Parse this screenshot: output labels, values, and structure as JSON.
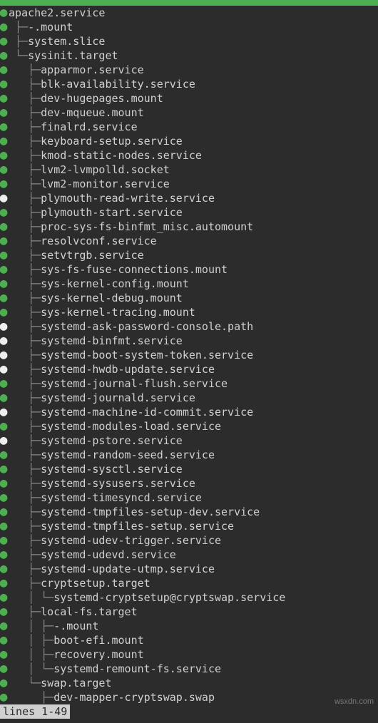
{
  "topbar_color": "#4caf50",
  "status_line": "lines 1-49",
  "watermark": "wsxdn.com",
  "root": {
    "name": "apache2.service",
    "bullet": "green"
  },
  "lines": [
    {
      "bullet": "green",
      "prefix": " ├─",
      "text": "-.mount"
    },
    {
      "bullet": "green",
      "prefix": " ├─",
      "text": "system.slice"
    },
    {
      "bullet": "green",
      "prefix": " └─",
      "text": "sysinit.target"
    },
    {
      "bullet": "green",
      "prefix": "   ├─",
      "text": "apparmor.service"
    },
    {
      "bullet": "green",
      "prefix": "   ├─",
      "text": "blk-availability.service"
    },
    {
      "bullet": "green",
      "prefix": "   ├─",
      "text": "dev-hugepages.mount"
    },
    {
      "bullet": "green",
      "prefix": "   ├─",
      "text": "dev-mqueue.mount"
    },
    {
      "bullet": "green",
      "prefix": "   ├─",
      "text": "finalrd.service"
    },
    {
      "bullet": "green",
      "prefix": "   ├─",
      "text": "keyboard-setup.service"
    },
    {
      "bullet": "green",
      "prefix": "   ├─",
      "text": "kmod-static-nodes.service"
    },
    {
      "bullet": "green",
      "prefix": "   ├─",
      "text": "lvm2-lvmpolld.socket"
    },
    {
      "bullet": "green",
      "prefix": "   ├─",
      "text": "lvm2-monitor.service"
    },
    {
      "bullet": "white",
      "prefix": "   ├─",
      "text": "plymouth-read-write.service"
    },
    {
      "bullet": "green",
      "prefix": "   ├─",
      "text": "plymouth-start.service"
    },
    {
      "bullet": "green",
      "prefix": "   ├─",
      "text": "proc-sys-fs-binfmt_misc.automount"
    },
    {
      "bullet": "green",
      "prefix": "   ├─",
      "text": "resolvconf.service"
    },
    {
      "bullet": "green",
      "prefix": "   ├─",
      "text": "setvtrgb.service"
    },
    {
      "bullet": "green",
      "prefix": "   ├─",
      "text": "sys-fs-fuse-connections.mount"
    },
    {
      "bullet": "green",
      "prefix": "   ├─",
      "text": "sys-kernel-config.mount"
    },
    {
      "bullet": "green",
      "prefix": "   ├─",
      "text": "sys-kernel-debug.mount"
    },
    {
      "bullet": "green",
      "prefix": "   ├─",
      "text": "sys-kernel-tracing.mount"
    },
    {
      "bullet": "white",
      "prefix": "   ├─",
      "text": "systemd-ask-password-console.path"
    },
    {
      "bullet": "white",
      "prefix": "   ├─",
      "text": "systemd-binfmt.service"
    },
    {
      "bullet": "white",
      "prefix": "   ├─",
      "text": "systemd-boot-system-token.service"
    },
    {
      "bullet": "white",
      "prefix": "   ├─",
      "text": "systemd-hwdb-update.service"
    },
    {
      "bullet": "green",
      "prefix": "   ├─",
      "text": "systemd-journal-flush.service"
    },
    {
      "bullet": "green",
      "prefix": "   ├─",
      "text": "systemd-journald.service"
    },
    {
      "bullet": "white",
      "prefix": "   ├─",
      "text": "systemd-machine-id-commit.service"
    },
    {
      "bullet": "green",
      "prefix": "   ├─",
      "text": "systemd-modules-load.service"
    },
    {
      "bullet": "white",
      "prefix": "   ├─",
      "text": "systemd-pstore.service"
    },
    {
      "bullet": "green",
      "prefix": "   ├─",
      "text": "systemd-random-seed.service"
    },
    {
      "bullet": "green",
      "prefix": "   ├─",
      "text": "systemd-sysctl.service"
    },
    {
      "bullet": "green",
      "prefix": "   ├─",
      "text": "systemd-sysusers.service"
    },
    {
      "bullet": "green",
      "prefix": "   ├─",
      "text": "systemd-timesyncd.service"
    },
    {
      "bullet": "green",
      "prefix": "   ├─",
      "text": "systemd-tmpfiles-setup-dev.service"
    },
    {
      "bullet": "green",
      "prefix": "   ├─",
      "text": "systemd-tmpfiles-setup.service"
    },
    {
      "bullet": "green",
      "prefix": "   ├─",
      "text": "systemd-udev-trigger.service"
    },
    {
      "bullet": "green",
      "prefix": "   ├─",
      "text": "systemd-udevd.service"
    },
    {
      "bullet": "green",
      "prefix": "   ├─",
      "text": "systemd-update-utmp.service"
    },
    {
      "bullet": "green",
      "prefix": "   ├─",
      "text": "cryptsetup.target"
    },
    {
      "bullet": "green",
      "prefix": "   │ └─",
      "text": "systemd-cryptsetup@cryptswap.service"
    },
    {
      "bullet": "green",
      "prefix": "   ├─",
      "text": "local-fs.target"
    },
    {
      "bullet": "green",
      "prefix": "   │ ├─",
      "text": "-.mount"
    },
    {
      "bullet": "green",
      "prefix": "   │ ├─",
      "text": "boot-efi.mount"
    },
    {
      "bullet": "green",
      "prefix": "   │ ├─",
      "text": "recovery.mount"
    },
    {
      "bullet": "green",
      "prefix": "   │ └─",
      "text": "systemd-remount-fs.service"
    },
    {
      "bullet": "green",
      "prefix": "   └─",
      "text": "swap.target"
    },
    {
      "bullet": "green",
      "prefix": "     ├─",
      "text": "dev-mapper-cryptswap.swap"
    }
  ]
}
